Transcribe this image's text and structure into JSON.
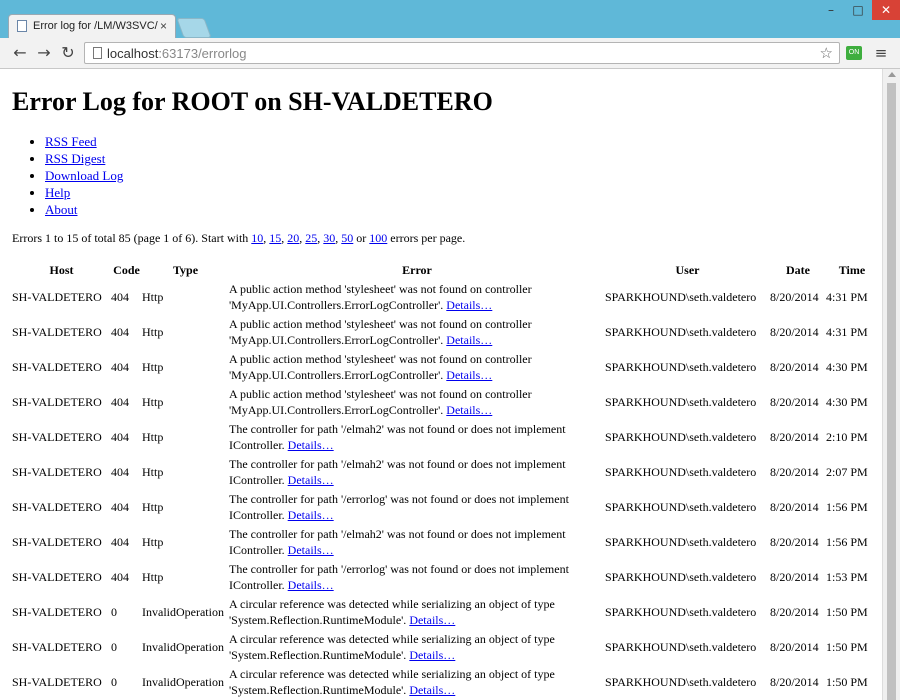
{
  "browser": {
    "tab_title": "Error log for /LM/W3SVC/",
    "tab_close": "×",
    "url_host": "localhost",
    "url_rest": ":63173/errorlog",
    "ext_label": "ON",
    "win_min": "–",
    "win_max": "□",
    "win_close": "✕"
  },
  "page": {
    "title": "Error Log for ROOT on SH-VALDETERO",
    "links": [
      "RSS Feed",
      "RSS Digest",
      "Download Log",
      "Help",
      "About"
    ],
    "pager": {
      "prefix": "Errors 1 to 15 of total 85 (page 1 of 6). Start with",
      "sizes": [
        "10",
        "15",
        "20",
        "25",
        "30",
        "50"
      ],
      "or": "or",
      "last": "100",
      "suffix": "errors per page."
    }
  },
  "table": {
    "headers": [
      "Host",
      "Code",
      "Type",
      "Error",
      "User",
      "Date",
      "Time"
    ],
    "details_label": "Details…",
    "rows": [
      {
        "host": "SH-VALDETERO",
        "code": "404",
        "type": "Http",
        "error": "A public action method 'stylesheet' was not found on controller 'MyApp.UI.Controllers.ErrorLogController'.",
        "user": "SPARKHOUND\\seth.valdetero",
        "date": "8/20/2014",
        "time": "4:31 PM"
      },
      {
        "host": "SH-VALDETERO",
        "code": "404",
        "type": "Http",
        "error": "A public action method 'stylesheet' was not found on controller 'MyApp.UI.Controllers.ErrorLogController'.",
        "user": "SPARKHOUND\\seth.valdetero",
        "date": "8/20/2014",
        "time": "4:31 PM"
      },
      {
        "host": "SH-VALDETERO",
        "code": "404",
        "type": "Http",
        "error": "A public action method 'stylesheet' was not found on controller 'MyApp.UI.Controllers.ErrorLogController'.",
        "user": "SPARKHOUND\\seth.valdetero",
        "date": "8/20/2014",
        "time": "4:30 PM"
      },
      {
        "host": "SH-VALDETERO",
        "code": "404",
        "type": "Http",
        "error": "A public action method 'stylesheet' was not found on controller 'MyApp.UI.Controllers.ErrorLogController'.",
        "user": "SPARKHOUND\\seth.valdetero",
        "date": "8/20/2014",
        "time": "4:30 PM"
      },
      {
        "host": "SH-VALDETERO",
        "code": "404",
        "type": "Http",
        "error": "The controller for path '/elmah2' was not found or does not implement IController.",
        "user": "SPARKHOUND\\seth.valdetero",
        "date": "8/20/2014",
        "time": "2:10 PM"
      },
      {
        "host": "SH-VALDETERO",
        "code": "404",
        "type": "Http",
        "error": "The controller for path '/elmah2' was not found or does not implement IController.",
        "user": "SPARKHOUND\\seth.valdetero",
        "date": "8/20/2014",
        "time": "2:07 PM"
      },
      {
        "host": "SH-VALDETERO",
        "code": "404",
        "type": "Http",
        "error": "The controller for path '/errorlog' was not found or does not implement IController.",
        "user": "SPARKHOUND\\seth.valdetero",
        "date": "8/20/2014",
        "time": "1:56 PM"
      },
      {
        "host": "SH-VALDETERO",
        "code": "404",
        "type": "Http",
        "error": "The controller for path '/elmah2' was not found or does not implement IController.",
        "user": "SPARKHOUND\\seth.valdetero",
        "date": "8/20/2014",
        "time": "1:56 PM"
      },
      {
        "host": "SH-VALDETERO",
        "code": "404",
        "type": "Http",
        "error": "The controller for path '/errorlog' was not found or does not implement IController.",
        "user": "SPARKHOUND\\seth.valdetero",
        "date": "8/20/2014",
        "time": "1:53 PM"
      },
      {
        "host": "SH-VALDETERO",
        "code": "0",
        "type": "InvalidOperation",
        "error": "A circular reference was detected while serializing an object of type 'System.Reflection.RuntimeModule'.",
        "user": "SPARKHOUND\\seth.valdetero",
        "date": "8/20/2014",
        "time": "1:50 PM"
      },
      {
        "host": "SH-VALDETERO",
        "code": "0",
        "type": "InvalidOperation",
        "error": "A circular reference was detected while serializing an object of type 'System.Reflection.RuntimeModule'.",
        "user": "SPARKHOUND\\seth.valdetero",
        "date": "8/20/2014",
        "time": "1:50 PM"
      },
      {
        "host": "SH-VALDETERO",
        "code": "0",
        "type": "InvalidOperation",
        "error": "A circular reference was detected while serializing an object of type 'System.Reflection.RuntimeModule'.",
        "user": "SPARKHOUND\\seth.valdetero",
        "date": "8/20/2014",
        "time": "1:50 PM"
      }
    ]
  }
}
